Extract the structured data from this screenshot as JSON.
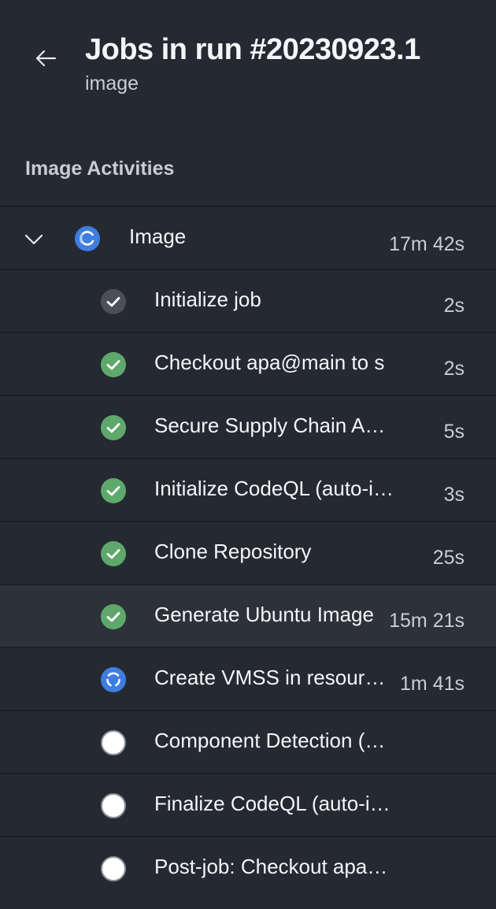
{
  "header": {
    "title": "Jobs in run #20230923.1",
    "subtitle": "image"
  },
  "section": {
    "title": "Image Activities"
  },
  "job": {
    "name": "Image",
    "duration": "17m 42s",
    "status": "in-progress"
  },
  "steps": [
    {
      "name": "Initialize job",
      "duration": "2s",
      "status": "success-neutral"
    },
    {
      "name": "Checkout apa@main to s",
      "duration": "2s",
      "status": "success"
    },
    {
      "name": "Secure Supply Chain Analysis",
      "duration": "5s",
      "status": "success"
    },
    {
      "name": "Initialize CodeQL (auto-injected)",
      "duration": "3s",
      "status": "success"
    },
    {
      "name": "Clone Repository",
      "duration": "25s",
      "status": "success"
    },
    {
      "name": "Generate Ubuntu Image",
      "duration": "15m 21s",
      "status": "success"
    },
    {
      "name": "Create VMSS in resource group",
      "duration": "1m 41s",
      "status": "in-progress"
    },
    {
      "name": "Component Detection (auto-injected)",
      "duration": "",
      "status": "pending"
    },
    {
      "name": "Finalize CodeQL (auto-injected)",
      "duration": "",
      "status": "pending"
    },
    {
      "name": "Post-job: Checkout apa@main",
      "duration": "",
      "status": "pending"
    }
  ],
  "colors": {
    "background": "#252932",
    "success": "#5fa86b",
    "neutral": "#4c4f57",
    "progress": "#3f7ee0",
    "pending": "#ffffff"
  }
}
